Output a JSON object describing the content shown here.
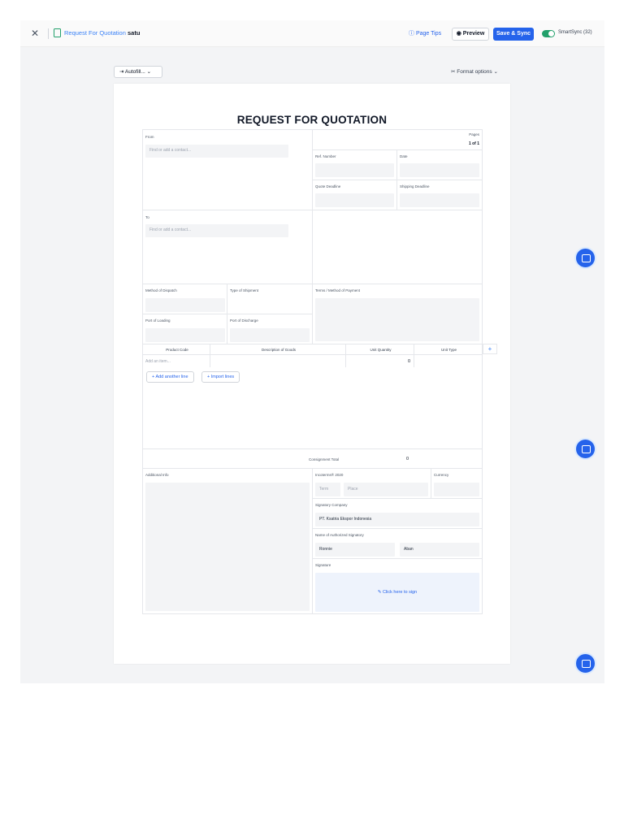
{
  "topbar": {
    "close_icon": "close-icon",
    "doc_icon": "document-icon",
    "title_prefix": "Request For Quotation",
    "title_name": "satu",
    "page_tips": "Page Tips",
    "preview": "Preview",
    "save_sync": "Save & Sync",
    "smartsync": "SmartSync (32)",
    "toggle_on": true,
    "colors": {
      "primary": "#2563eb",
      "toggle": "#22a06b"
    }
  },
  "toolbar": {
    "autofill": "Autofill...",
    "format_options": "Format options"
  },
  "document": {
    "title": "REQUEST FOR QUOTATION",
    "from_label": "From",
    "from_placeholder": "Find or add a contact...",
    "to_label": "To",
    "to_placeholder": "Find or add a contact...",
    "pages_label": "Pages",
    "pages_value": "1 of 1",
    "ref_label": "Ref. Number",
    "date_label": "Date",
    "quote_deadline_label": "Quote Deadline",
    "shipping_deadline_label": "Shipping Deadline",
    "dispatch_label": "Method of Dispatch",
    "shipment_label": "Type of Shipment",
    "terms_label": "Terms / Method of Payment",
    "loading_label": "Port of Loading",
    "discharge_label": "Port of Discharge",
    "table": {
      "headers": [
        "Product Code",
        "Description of Goods",
        "Unit Quantity",
        "Unit Type"
      ],
      "add_item_placeholder": "Add an item...",
      "quantity": "0"
    },
    "add_line": "Add another line",
    "import_lines": "Import lines",
    "consignment_label": "Consignment Total",
    "consignment_value": "0",
    "additional_label": "Additional Info",
    "incoterms_label": "Incoterms® 2020",
    "term_placeholder": "Term",
    "place_placeholder": "Place",
    "currency_label": "Currency",
    "signatory_company_label": "Signatory Company",
    "signatory_company": "PT. Ksatria Ekspor Indonesia",
    "authorized_label": "Name of Authorized Signatory",
    "first_name": "Ronnie",
    "last_name": "Aban",
    "signature_label": "Signature",
    "sign_cta": "Click here to sign"
  },
  "chat_icon": "chat-icon"
}
